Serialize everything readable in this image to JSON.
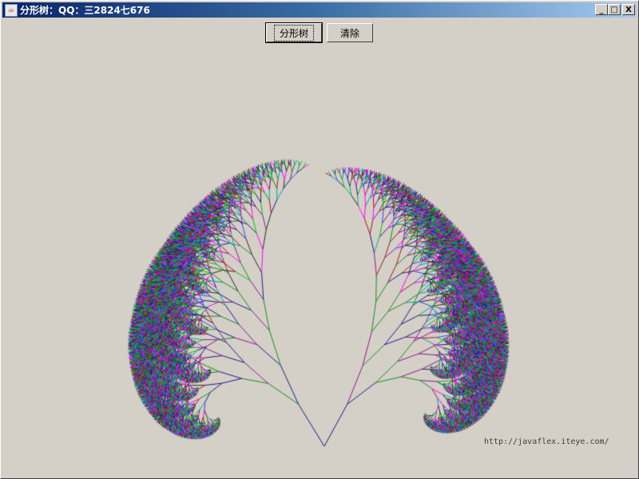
{
  "window": {
    "title": "分形树：QQ：三2824七676",
    "icon": "java-cup-icon",
    "controls": [
      "_",
      "□",
      "X"
    ]
  },
  "toolbar": {
    "fractal_label": "分形树",
    "clear_label": "清除"
  },
  "canvas": {
    "url_text": "http://javaflex.iteye.com/",
    "palette": [
      "#1a1a8a",
      "#8a1a8a",
      "#1a8a1a",
      "#00a0a0",
      "#a01a1a",
      "#2a2a2a",
      "#4040ff",
      "#ff00ff",
      "#00c000"
    ]
  }
}
